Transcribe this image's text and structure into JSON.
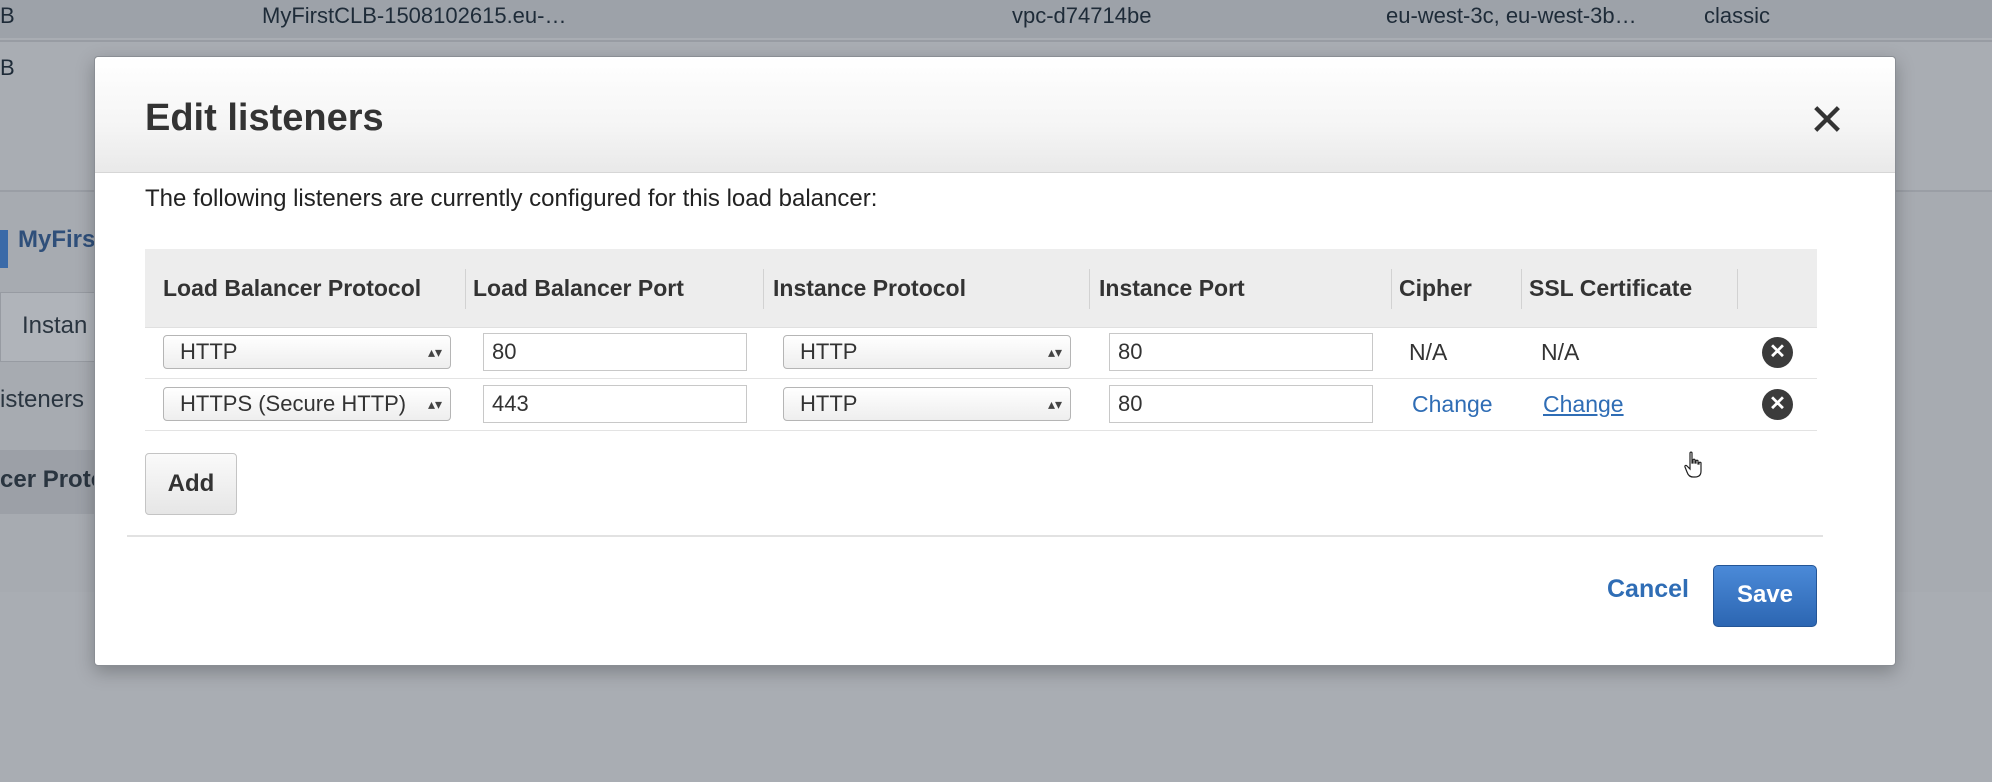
{
  "background": {
    "row1": {
      "col1": "B",
      "dns_name": "MyFirstCLB-1508102615.eu-…",
      "vpc": "vpc-d74714be",
      "zones": "eu-west-3c, eu-west-3b…",
      "type": "classic"
    },
    "row2": {
      "col1": "B"
    },
    "selected_name": "MyFirs",
    "tab_partial": "Instan",
    "listeners_partial": "isteners",
    "column_partial": "cer Proto"
  },
  "modal": {
    "title": "Edit listeners",
    "close_glyph": "✕",
    "intro": "The following listeners are currently configured for this load balancer:",
    "columns": {
      "lb_protocol": "Load Balancer Protocol",
      "lb_port": "Load Balancer Port",
      "instance_protocol": "Instance Protocol",
      "instance_port": "Instance Port",
      "cipher": "Cipher",
      "ssl_certificate": "SSL Certificate"
    },
    "rows": [
      {
        "lb_protocol": "HTTP",
        "lb_port": "80",
        "instance_protocol": "HTTP",
        "instance_port": "80",
        "cipher": "N/A",
        "ssl_certificate": "N/A"
      },
      {
        "lb_protocol": "HTTPS (Secure HTTP)",
        "lb_port": "443",
        "instance_protocol": "HTTP",
        "instance_port": "80",
        "cipher": "Change",
        "ssl_certificate": "Change"
      }
    ],
    "remove_glyph": "✕",
    "select_arrows": "▴▾",
    "add_label": "Add",
    "cancel_label": "Cancel",
    "save_label": "Save"
  },
  "colors": {
    "link": "#2f6db5",
    "primary_button": "#3a78c8",
    "overlay": "#a9adb3"
  }
}
